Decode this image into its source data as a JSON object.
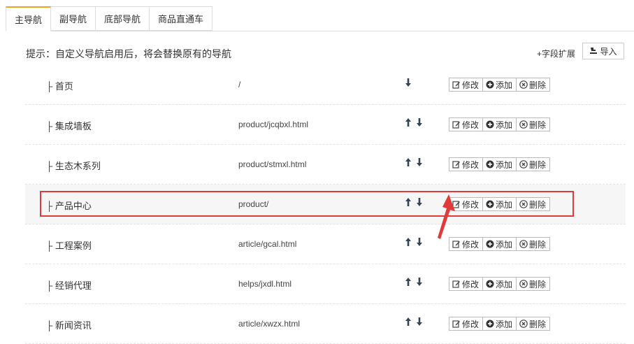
{
  "tabs": [
    {
      "label": "主导航",
      "active": true
    },
    {
      "label": "副导航",
      "active": false
    },
    {
      "label": "底部导航",
      "active": false
    },
    {
      "label": "商品直通车",
      "active": false
    }
  ],
  "tip": "提示：自定义导航启用后，将会替换原有的导航",
  "toolbar": {
    "field_ext": "+字段扩展",
    "import": "导入"
  },
  "rows": [
    {
      "name": "├ 首页",
      "url": "/",
      "up": false,
      "down": true
    },
    {
      "name": "├ 集成墙板",
      "url": "product/jcqbxl.html",
      "up": true,
      "down": true
    },
    {
      "name": "├ 生态木系列",
      "url": "product/stmxl.html",
      "up": true,
      "down": true
    },
    {
      "name": "├ 产品中心",
      "url": "product/",
      "up": true,
      "down": true,
      "highlighted": true
    },
    {
      "name": "├ 工程案例",
      "url": "article/gcal.html",
      "up": true,
      "down": true
    },
    {
      "name": "├ 经销代理",
      "url": "helps/jxdl.html",
      "up": true,
      "down": true
    },
    {
      "name": "├ 新闻资讯",
      "url": "article/xwzx.html",
      "up": true,
      "down": true
    }
  ],
  "actions": {
    "edit": "修改",
    "add": "添加",
    "delete": "删除"
  },
  "colors": {
    "accent": "#f0a21a",
    "annotation": "#e03a3a",
    "arrow": "#334455"
  },
  "icons": {
    "edit": "edit-icon",
    "add": "plus-circle-icon",
    "delete": "x-circle-icon",
    "import": "import-icon",
    "up": "arrow-up-icon",
    "down": "arrow-down-icon"
  }
}
